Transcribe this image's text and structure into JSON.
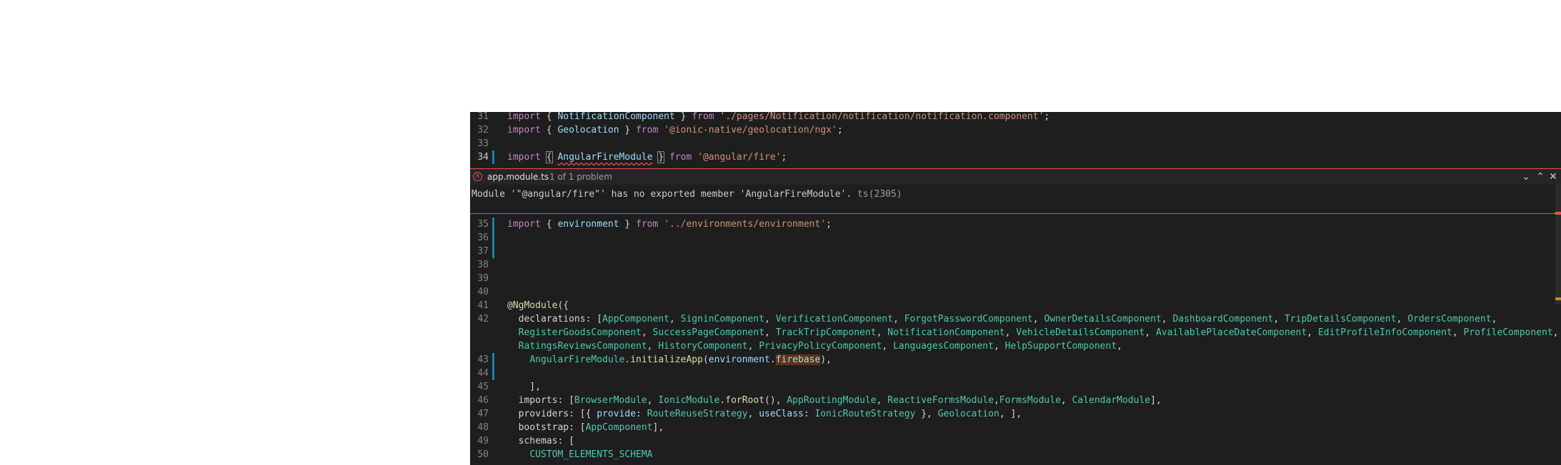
{
  "editor": {
    "lines_top": [
      {
        "num": "31",
        "tokens": [
          {
            "t": "import",
            "c": "kw"
          },
          {
            "t": " { ",
            "c": "pun"
          },
          {
            "t": "NotificationComponent",
            "c": "id"
          },
          {
            "t": " } ",
            "c": "pun"
          },
          {
            "t": "from",
            "c": "kw"
          },
          {
            "t": " ",
            "c": "pun"
          },
          {
            "t": "'./pages/Notification/notification/notification.component'",
            "c": "str"
          },
          {
            "t": ";",
            "c": "pun"
          }
        ]
      },
      {
        "num": "32",
        "tokens": [
          {
            "t": "import",
            "c": "kw"
          },
          {
            "t": " { ",
            "c": "pun"
          },
          {
            "t": "Geolocation",
            "c": "id"
          },
          {
            "t": " } ",
            "c": "pun"
          },
          {
            "t": "from",
            "c": "kw"
          },
          {
            "t": " ",
            "c": "pun"
          },
          {
            "t": "'@ionic-native/geolocation/ngx'",
            "c": "str"
          },
          {
            "t": ";",
            "c": "pun"
          }
        ]
      },
      {
        "num": "33",
        "tokens": []
      },
      {
        "num": "34",
        "tokens": [
          {
            "t": "import",
            "c": "kw"
          },
          {
            "t": " ",
            "c": "pun"
          },
          {
            "t": "{",
            "c": "pun bracket"
          },
          {
            "t": " ",
            "c": "pun"
          },
          {
            "t": "AngularFireModule",
            "c": "id sq"
          },
          {
            "t": " ",
            "c": "pun"
          },
          {
            "t": "}",
            "c": "pun bracket"
          },
          {
            "t": " ",
            "c": "pun"
          },
          {
            "t": "from",
            "c": "kw"
          },
          {
            "t": " ",
            "c": "pun"
          },
          {
            "t": "'@angular/fire'",
            "c": "str"
          },
          {
            "t": ";",
            "c": "pun"
          }
        ]
      }
    ],
    "lines_bottom": [
      {
        "num": "35",
        "tokens": [
          {
            "t": "import",
            "c": "kw"
          },
          {
            "t": " { ",
            "c": "pun"
          },
          {
            "t": "environment",
            "c": "id"
          },
          {
            "t": " } ",
            "c": "pun"
          },
          {
            "t": "from",
            "c": "kw"
          },
          {
            "t": " ",
            "c": "pun"
          },
          {
            "t": "'../environments/environment'",
            "c": "str"
          },
          {
            "t": ";",
            "c": "pun"
          }
        ]
      },
      {
        "num": "36",
        "tokens": []
      },
      {
        "num": "37",
        "tokens": []
      },
      {
        "num": "38",
        "tokens": []
      },
      {
        "num": "39",
        "tokens": []
      },
      {
        "num": "40",
        "tokens": []
      },
      {
        "num": "41",
        "tokens": [
          {
            "t": "@",
            "c": "pun"
          },
          {
            "t": "NgModule",
            "c": "fn"
          },
          {
            "t": "({",
            "c": "pun"
          }
        ]
      },
      {
        "num": "42",
        "tokens": [
          {
            "t": "  declarations: [",
            "c": "pun"
          },
          {
            "t": "AppComponent",
            "c": "cls"
          },
          {
            "t": ", ",
            "c": "pun"
          },
          {
            "t": "SigninComponent",
            "c": "cls"
          },
          {
            "t": ", ",
            "c": "pun"
          },
          {
            "t": "VerificationComponent",
            "c": "cls"
          },
          {
            "t": ", ",
            "c": "pun"
          },
          {
            "t": "ForgotPasswordComponent",
            "c": "cls"
          },
          {
            "t": ", ",
            "c": "pun"
          },
          {
            "t": "OwnerDetailsComponent",
            "c": "cls"
          },
          {
            "t": ", ",
            "c": "pun"
          },
          {
            "t": "DashboardComponent",
            "c": "cls"
          },
          {
            "t": ", ",
            "c": "pun"
          },
          {
            "t": "TripDetailsComponent",
            "c": "cls"
          },
          {
            "t": ", ",
            "c": "pun"
          },
          {
            "t": "OrdersComponent",
            "c": "cls"
          },
          {
            "t": ",",
            "c": "pun"
          }
        ]
      },
      {
        "num": "",
        "tokens": [
          {
            "t": "  ",
            "c": "pun"
          },
          {
            "t": "RegisterGoodsComponent",
            "c": "cls"
          },
          {
            "t": ", ",
            "c": "pun"
          },
          {
            "t": "SuccessPageComponent",
            "c": "cls"
          },
          {
            "t": ", ",
            "c": "pun"
          },
          {
            "t": "TrackTripComponent",
            "c": "cls"
          },
          {
            "t": ", ",
            "c": "pun"
          },
          {
            "t": "NotificationComponent",
            "c": "cls"
          },
          {
            "t": ", ",
            "c": "pun"
          },
          {
            "t": "VehicleDetailsComponent",
            "c": "cls"
          },
          {
            "t": ", ",
            "c": "pun"
          },
          {
            "t": "AvailablePlaceDateComponent",
            "c": "cls"
          },
          {
            "t": ", ",
            "c": "pun"
          },
          {
            "t": "EditProfileInfoComponent",
            "c": "cls"
          },
          {
            "t": ", ",
            "c": "pun"
          },
          {
            "t": "ProfileComponent",
            "c": "cls"
          },
          {
            "t": ",",
            "c": "pun"
          }
        ]
      },
      {
        "num": "",
        "tokens": [
          {
            "t": "  ",
            "c": "pun"
          },
          {
            "t": "RatingsReviewsComponent",
            "c": "cls"
          },
          {
            "t": ", ",
            "c": "pun"
          },
          {
            "t": "HistoryComponent",
            "c": "cls"
          },
          {
            "t": ", ",
            "c": "pun"
          },
          {
            "t": "PrivacyPolicyComponent",
            "c": "cls"
          },
          {
            "t": ", ",
            "c": "pun"
          },
          {
            "t": "LanguagesComponent",
            "c": "cls"
          },
          {
            "t": ", ",
            "c": "pun"
          },
          {
            "t": "HelpSupportComponent",
            "c": "cls"
          },
          {
            "t": ",",
            "c": "pun"
          }
        ]
      },
      {
        "num": "43",
        "tokens": [
          {
            "t": "    ",
            "c": "pun"
          },
          {
            "t": "AngularFireModule",
            "c": "cls"
          },
          {
            "t": ".",
            "c": "pun"
          },
          {
            "t": "initializeApp",
            "c": "fn"
          },
          {
            "t": "(",
            "c": "pun"
          },
          {
            "t": "environment",
            "c": "id"
          },
          {
            "t": ".",
            "c": "pun"
          },
          {
            "t": "firebase",
            "c": "id hl"
          },
          {
            "t": "),",
            "c": "pun"
          }
        ]
      },
      {
        "num": "44",
        "tokens": []
      },
      {
        "num": "45",
        "tokens": [
          {
            "t": "    ],",
            "c": "pun"
          }
        ]
      },
      {
        "num": "46",
        "tokens": [
          {
            "t": "  imports: [",
            "c": "pun"
          },
          {
            "t": "BrowserModule",
            "c": "cls"
          },
          {
            "t": ", ",
            "c": "pun"
          },
          {
            "t": "IonicModule",
            "c": "cls"
          },
          {
            "t": ".",
            "c": "pun"
          },
          {
            "t": "forRoot",
            "c": "fn"
          },
          {
            "t": "(), ",
            "c": "pun"
          },
          {
            "t": "AppRoutingModule",
            "c": "cls"
          },
          {
            "t": ", ",
            "c": "pun"
          },
          {
            "t": "ReactiveFormsModule",
            "c": "cls"
          },
          {
            "t": ",",
            "c": "pun"
          },
          {
            "t": "FormsModule",
            "c": "cls"
          },
          {
            "t": ", ",
            "c": "pun"
          },
          {
            "t": "CalendarModule",
            "c": "cls"
          },
          {
            "t": "],",
            "c": "pun"
          }
        ]
      },
      {
        "num": "47",
        "tokens": [
          {
            "t": "  providers: [{ ",
            "c": "pun"
          },
          {
            "t": "provide",
            "c": "id"
          },
          {
            "t": ": ",
            "c": "pun"
          },
          {
            "t": "RouteReuseStrategy",
            "c": "cls"
          },
          {
            "t": ", ",
            "c": "pun"
          },
          {
            "t": "useClass",
            "c": "id"
          },
          {
            "t": ": ",
            "c": "pun"
          },
          {
            "t": "IonicRouteStrategy",
            "c": "cls"
          },
          {
            "t": " }, ",
            "c": "pun"
          },
          {
            "t": "Geolocation",
            "c": "cls"
          },
          {
            "t": ", ],",
            "c": "pun"
          }
        ]
      },
      {
        "num": "48",
        "tokens": [
          {
            "t": "  bootstrap: [",
            "c": "pun"
          },
          {
            "t": "AppComponent",
            "c": "cls"
          },
          {
            "t": "],",
            "c": "pun"
          }
        ]
      },
      {
        "num": "49",
        "tokens": [
          {
            "t": "  schemas: [",
            "c": "pun"
          }
        ]
      },
      {
        "num": "50",
        "tokens": [
          {
            "t": "    ",
            "c": "pun"
          },
          {
            "t": "CUSTOM_ELEMENTS_SCHEMA",
            "c": "cls"
          }
        ]
      }
    ]
  },
  "peek": {
    "file_name": "app.module.ts",
    "problem_count": "1 of 1 problem",
    "message": "Module '\"@angular/fire\"' has no exported member 'AngularFireModule'.",
    "code_ref": "ts(2305)",
    "icons": {
      "error": "error-circle-icon",
      "next": "chevron-down-icon",
      "prev": "chevron-up-icon",
      "close": "close-icon"
    },
    "error_glyph": "×",
    "next_glyph": "⌄",
    "prev_glyph": "⌃",
    "close_glyph": "✕"
  },
  "colors": {
    "editor_bg": "#1e1e1e",
    "error": "#f14c4c",
    "keyword": "#c586c0",
    "string": "#ce9178",
    "identifier": "#9cdcfe",
    "type": "#4ec9b0",
    "function": "#dcdcaa",
    "gutter_modified": "#1b81a8"
  }
}
